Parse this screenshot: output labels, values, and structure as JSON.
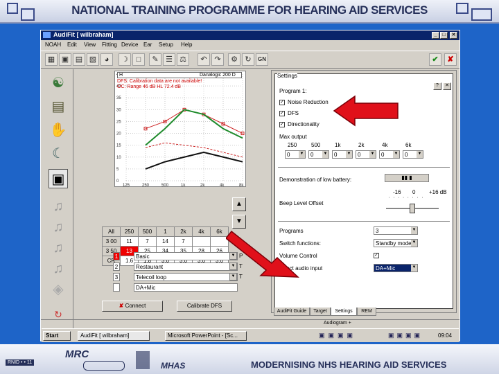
{
  "slide": {
    "title": "NATIONAL TRAINING PROGRAMME FOR  HEARING AID SERVICES",
    "footer": {
      "rnid": "RNID • • 11",
      "mrc": "MRC",
      "mhas": "MHAS",
      "tagline": "MODERNISING NHS HEARING AID SERVICES"
    }
  },
  "window": {
    "title": "AudiFit [ wilbraham]",
    "controls": [
      "_",
      "□",
      "✕"
    ],
    "menu": [
      "NOAH",
      "Edit",
      "View",
      "Fitting",
      "Device",
      "Ear",
      "Setup",
      "Help"
    ]
  },
  "audiogram": {
    "header_left": "H",
    "header_right": "Danalogic 200 D",
    "notes": [
      "DFS: Calibration data are not available!",
      "OC: Range 46 dB HL 72.4 dB"
    ],
    "y_ticks": [
      "45",
      "40",
      "35",
      "30",
      "25",
      "20",
      "15",
      "10",
      "5",
      "0"
    ],
    "x_ticks": [
      "125",
      "250",
      "500",
      "1k",
      "2k",
      "4k",
      "8k"
    ],
    "series": [
      {
        "name": "red",
        "color": "#cc2222",
        "values": [
          0,
          22,
          25,
          30,
          28,
          24,
          20
        ]
      },
      {
        "name": "green",
        "color": "#1d8a2a",
        "values": [
          0,
          15,
          22,
          30,
          28,
          22,
          18
        ]
      },
      {
        "name": "black",
        "color": "#111111",
        "values": [
          0,
          5,
          8,
          10,
          12,
          10,
          8
        ]
      },
      {
        "name": "dashed-red",
        "color": "#cc2222",
        "values": [
          0,
          14,
          16,
          15,
          14,
          12,
          10
        ]
      }
    ]
  },
  "gain_table": {
    "header": [
      "All",
      "250",
      "500",
      "1",
      "2k",
      "4k",
      "6k"
    ],
    "rows": [
      [
        "3 00",
        "11",
        "7",
        "14",
        "7",
        "",
        ""
      ],
      [
        "3 50",
        "13",
        "25",
        "34",
        "35",
        "28",
        "26"
      ],
      [
        "CR",
        "1.6",
        "1.8",
        "3.0",
        "3.0",
        "3.0",
        "3.0"
      ]
    ]
  },
  "programs": [
    {
      "num": "1",
      "name": "Basic",
      "tag": "P"
    },
    {
      "num": "2",
      "name": "Restaurant",
      "tag": "T"
    },
    {
      "num": "3",
      "name": "Telecoil loop",
      "tag": "T"
    },
    {
      "num": "",
      "name": "DA+Mic",
      "tag": ""
    }
  ],
  "buttons": {
    "connect": "Connect",
    "calibrate": "Calibrate DFS"
  },
  "settings": {
    "group_label": "Settings",
    "program_label": "Program 1:",
    "checks": [
      {
        "label": "Noise Reduction",
        "checked": true
      },
      {
        "label": "DFS",
        "checked": true
      },
      {
        "label": "Directionality",
        "checked": true
      }
    ],
    "max_output_label": "Max output",
    "freq_labels": [
      "250",
      "500",
      "1k",
      "2k",
      "4k",
      "6k"
    ],
    "freq_values": [
      "0",
      "0",
      "0",
      "0",
      "0",
      "0"
    ],
    "battery_label": "Demonstration of low battery:",
    "beep_label": "Beep Level Offset",
    "beep_scale": [
      "-16",
      "0",
      "+16 dB"
    ],
    "programs_label": "Programs",
    "programs_value": "3",
    "switch_label": "Switch functions:",
    "switch_value": "Standby mode",
    "volume_label": "Volume Control",
    "volume_checked": true,
    "direct_label": "Direct audio input",
    "direct_value": "DA+Mic"
  },
  "tabs": [
    "AudiFit Guide",
    "Target",
    "Settings",
    "REM"
  ],
  "status": "Audiogram +",
  "taskbar": {
    "start": "Start",
    "tasks": [
      "AudiFit [ wilbraham]",
      "Microsoft PowerPoint - [Sc..."
    ],
    "clock": "09:04"
  },
  "colors": {
    "slide_bg": "#1e64c8",
    "arrow": "#e0101a",
    "titlebar": "#0a246a"
  }
}
